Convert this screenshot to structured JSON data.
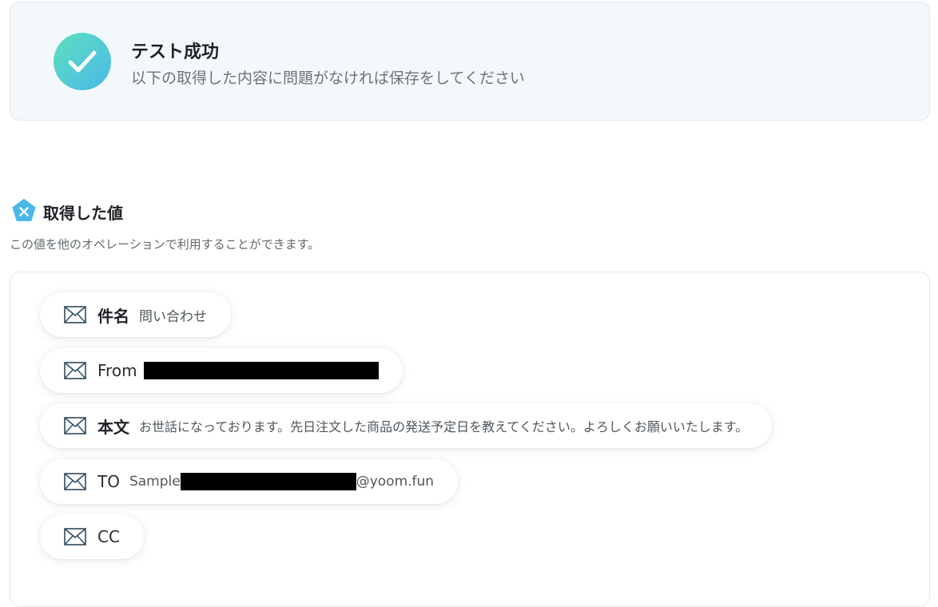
{
  "banner": {
    "title": "テスト成功",
    "subtitle": "以下の取得した内容に問題がなければ保存をしてください",
    "accent_gradient": [
      "#5ee0c0",
      "#4ab8e8"
    ]
  },
  "section": {
    "title": "取得した値",
    "description": "この値を他のオペレーションで利用することができます。",
    "icon_color": "#4ab8e8"
  },
  "values": [
    {
      "key": "件名",
      "value": "問い合わせ"
    },
    {
      "key": "From",
      "value": ""
    },
    {
      "key": "本文",
      "value": "お世話になっております。先日注文した商品の発送予定日を教えてください。よろしくお願いいたします。"
    },
    {
      "key": "TO",
      "value_prefix": "Sample",
      "value_suffix": "@yoom.fun"
    },
    {
      "key": "CC",
      "value": ""
    }
  ]
}
